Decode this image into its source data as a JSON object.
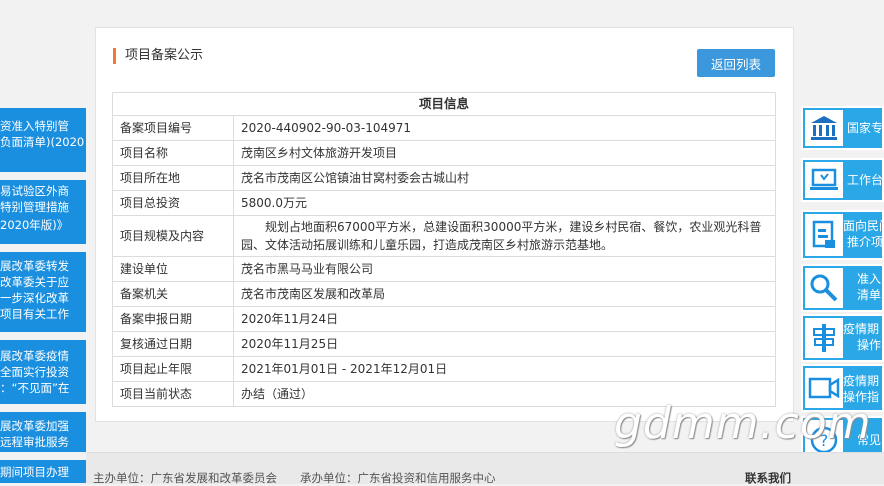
{
  "left_banners": [
    {
      "lines": [
        "资准入特别管",
        "负面清单)(2020"
      ]
    },
    {
      "lines": [
        "易试验区外商",
        "特别管理措施",
        "",
        "2020年版)》"
      ]
    },
    {
      "lines": [
        "展改革委转发",
        "改革委关于应",
        "一步深化改革",
        "项目有关工作"
      ]
    },
    {
      "lines": [
        "展改革委疫情",
        "全面实行投资",
        "：“不见面”在"
      ]
    },
    {
      "lines": [
        "展改革委加强",
        "远程审批服务"
      ]
    },
    {
      "lines": [
        "期间项目办理"
      ]
    }
  ],
  "right_nav": [
    {
      "icon": "bank-icon",
      "text": "国家专"
    },
    {
      "icon": "laptop-icon",
      "text": "工作台"
    },
    {
      "icon": "document-icon",
      "text": "面向民间",
      "text2": "推介项"
    },
    {
      "icon": "search-icon",
      "text": "准入",
      "text2": "清单"
    },
    {
      "icon": "signpost-icon",
      "text": "疫情期",
      "text2": "操作"
    },
    {
      "icon": "video-icon",
      "text": "疫情期",
      "text2": "操作指"
    },
    {
      "icon": "question-icon",
      "text": "常见"
    }
  ],
  "card": {
    "title": "项目备案公示",
    "back_label": "返回列表",
    "table_header": "项目信息",
    "rows": [
      {
        "key": "备案项目编号",
        "value": "2020-440902-90-03-104971"
      },
      {
        "key": "项目名称",
        "value": "茂南区乡村文体旅游开发项目"
      },
      {
        "key": "项目所在地",
        "value": "茂名市茂南区公馆镇油甘窝村委会古城山村"
      },
      {
        "key": "项目总投资",
        "value": "5800.0万元"
      },
      {
        "key": "项目规模及内容",
        "value": "规划占地面积67000平方米，总建设面积30000平方米，建设乡村民宿、餐饮，农业观光科普园、文体活动拓展训练和儿童乐园，打造成茂南区乡村旅游示范基地。"
      },
      {
        "key": "建设单位",
        "value": "茂名市黑马马业有限公司"
      },
      {
        "key": "备案机关",
        "value": "茂名市茂南区发展和改革局"
      },
      {
        "key": "备案申报日期",
        "value": "2020年11月24日"
      },
      {
        "key": "复核通过日期",
        "value": "2020年11月25日"
      },
      {
        "key": "项目起止年限",
        "value": "2021年01月01日 - 2021年12月01日"
      },
      {
        "key": "项目当前状态",
        "value": "办结（通过）"
      }
    ]
  },
  "footer": {
    "host": "主办单位：广东省发展和改革委员会",
    "organizer": "承办单位：广东省投资和信用服务中心",
    "contact": "联系我们"
  },
  "watermark": "gdmm.com"
}
